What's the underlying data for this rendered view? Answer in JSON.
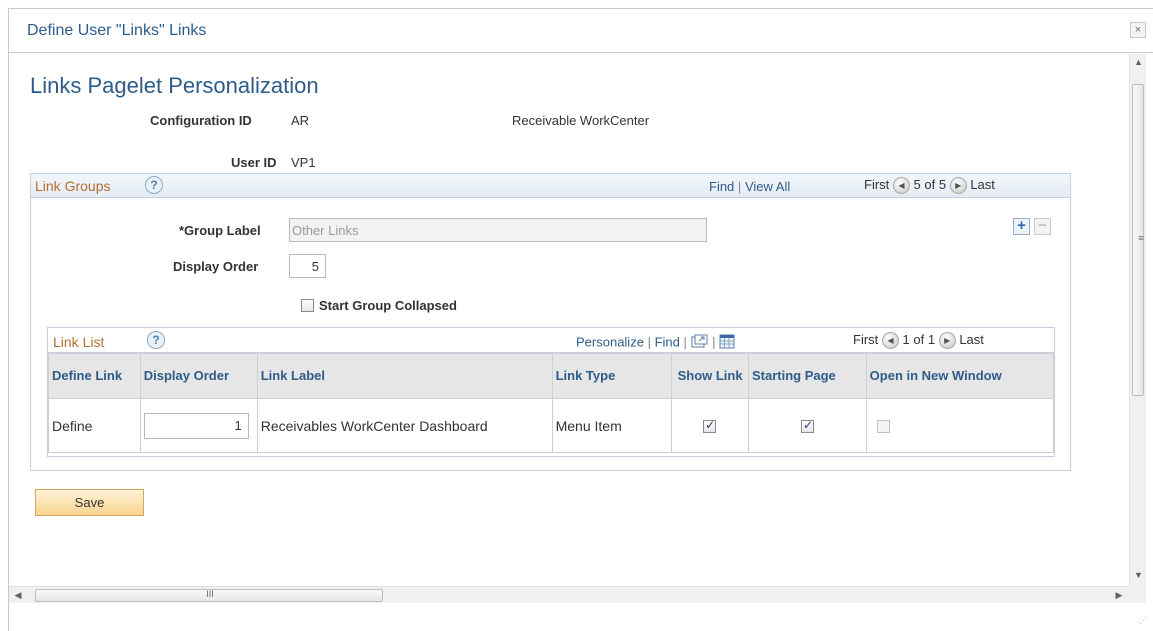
{
  "dialog": {
    "title": "Define User \"Links\" Links",
    "close_icon": "×"
  },
  "page": {
    "title": "Links Pagelet Personalization"
  },
  "header_fields": {
    "config_label": "Configuration ID",
    "config_value": "AR",
    "config_desc": "Receivable WorkCenter",
    "user_label": "User ID",
    "user_value": "VP1"
  },
  "link_groups": {
    "title": "Link Groups",
    "help": "?",
    "find": "Find",
    "view_all": "View All",
    "first": "First",
    "counter": "5 of 5",
    "last": "Last",
    "sep": "|",
    "group_label_label": "*Group Label",
    "group_label_value": "Other Links",
    "display_order_label": "Display Order",
    "display_order_value": "5",
    "start_collapsed_label": "Start Group Collapsed",
    "start_collapsed_checked": false,
    "add_icon": "+",
    "delete_icon": "−"
  },
  "link_list": {
    "title": "Link List",
    "help": "?",
    "personalize": "Personalize",
    "find": "Find",
    "sep": "|",
    "first": "First",
    "counter": "1 of 1",
    "last": "Last",
    "columns": {
      "define_link": "Define Link",
      "display_order": "Display Order",
      "link_label": "Link Label",
      "link_type": "Link Type",
      "show_link": "Show Link",
      "starting_page": "Starting Page",
      "open_new_window": "Open in New Window"
    },
    "rows": [
      {
        "define": "Define",
        "display_order": "1",
        "link_label": "Receivables WorkCenter Dashboard",
        "link_type": "Menu Item",
        "show_link": true,
        "starting_page": true,
        "open_new_window": false
      }
    ]
  },
  "actions": {
    "save": "Save"
  },
  "icons": {
    "prev_arrow": "◀",
    "next_arrow": "▶",
    "scroll_up": "▲",
    "scroll_down": "▼",
    "scroll_left": "◀",
    "scroll_right": "▶",
    "vgrip": "≡",
    "hgrip": "III",
    "resize": "⋰"
  },
  "colors": {
    "link_blue": "#2e5c8a",
    "group_title_orange": "#b46f32",
    "save_button": "#f8d48f"
  }
}
